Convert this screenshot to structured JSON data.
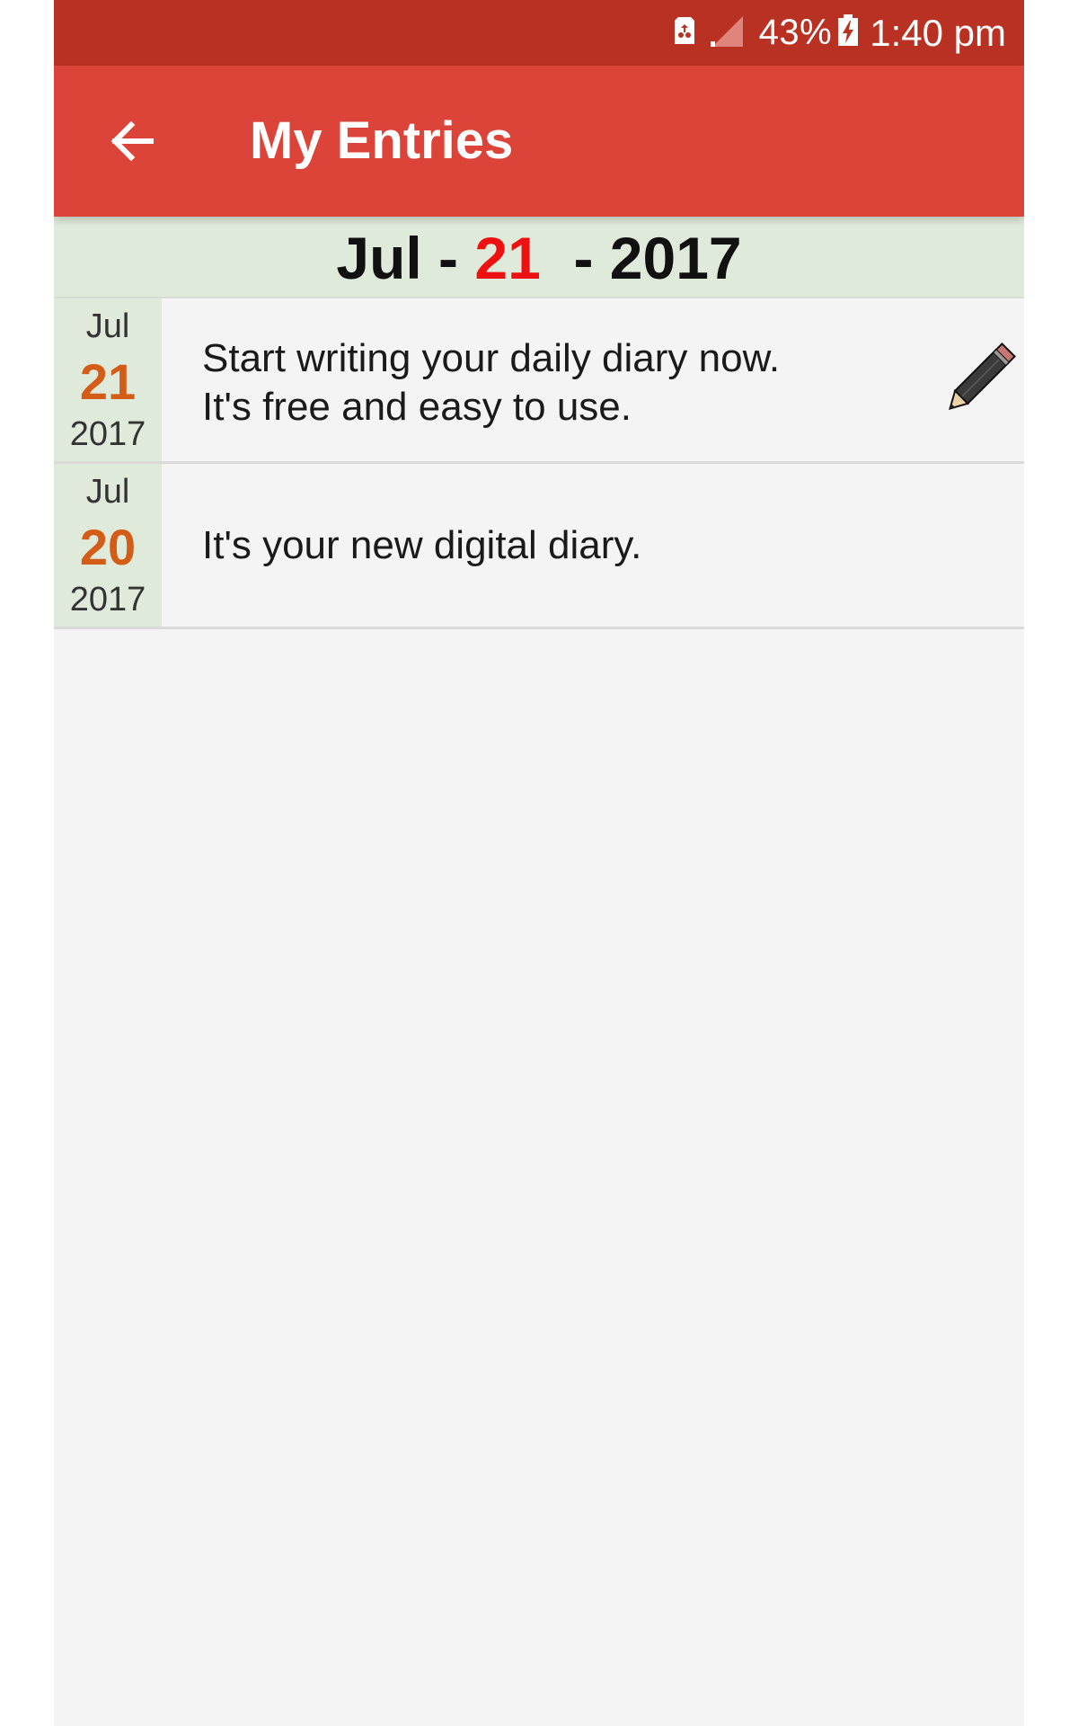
{
  "status_bar": {
    "battery_percent": "43%",
    "time": "1:40 pm",
    "icons": [
      "sim-card-icon",
      "signal-icon",
      "battery-charging-icon"
    ]
  },
  "toolbar": {
    "title": "My Entries",
    "back_icon": "arrow-left-icon"
  },
  "date_header": {
    "month": "Jul",
    "day": "21",
    "year": "2017",
    "sep1": " - ",
    "sep2": "  - "
  },
  "entries": [
    {
      "month": "Jul",
      "day": "21",
      "year": "2017",
      "lines": [
        "Start writing your daily diary now.",
        "It's free and easy to use."
      ],
      "icon": "pencil-icon"
    },
    {
      "month": "Jul",
      "day": "20",
      "year": "2017",
      "lines": [
        "It's your new digital diary."
      ]
    }
  ],
  "colors": {
    "status_bar": "#b93122",
    "toolbar": "#dd4439",
    "date_panel": "#dfeadb",
    "day_highlight": "#ee1111",
    "entry_day": "#d35c16",
    "background": "#f4f4f4"
  }
}
